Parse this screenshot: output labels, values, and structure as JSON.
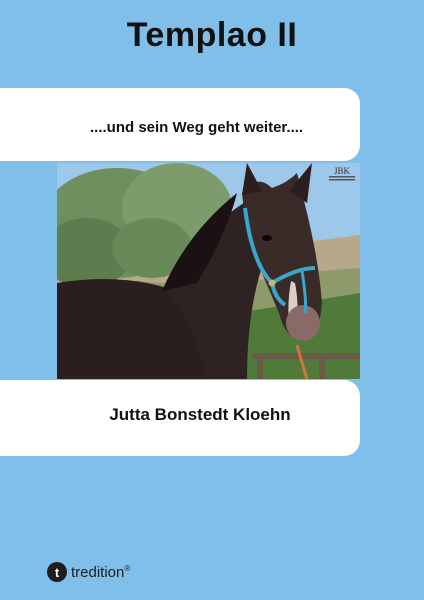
{
  "cover": {
    "title": "Templao II",
    "subtitle": "....und sein Weg geht weiter....",
    "author": "Jutta Bonstedt Kloehn",
    "photo_logo": "JBK",
    "publisher": "tredition",
    "publisher_mark": "®"
  },
  "icons": {
    "publisher_logo": "tredition-logo-icon"
  },
  "colors": {
    "background": "#7fbfea",
    "band": "#ffffff",
    "text": "#111111"
  }
}
